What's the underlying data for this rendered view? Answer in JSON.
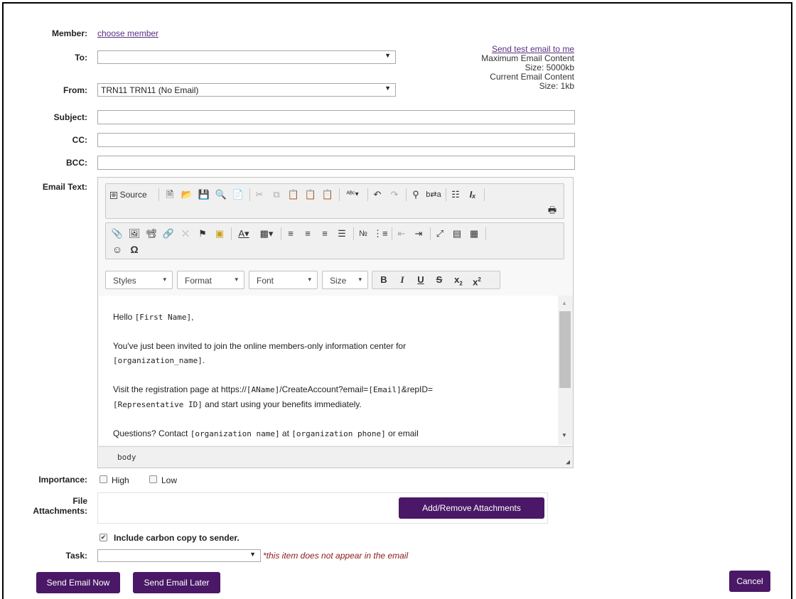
{
  "form": {
    "member_label": "Member:",
    "member_link": "choose member",
    "to_label": "To:",
    "to_value": "",
    "from_label": "From:",
    "from_value": "TRN11 TRN11 (No Email)",
    "subject_label": "Subject:",
    "cc_label": "CC:",
    "bcc_label": "BCC:",
    "email_text_label": "Email Text:",
    "importance_label": "Importance:",
    "importance_high": "High",
    "importance_low": "Low",
    "file_label_1": "File",
    "file_label_2": "Attachments:",
    "add_attachments": "Add/Remove Attachments",
    "carbon_copy_label": "Include carbon copy to sender.",
    "carbon_copy_checked": true,
    "task_label": "Task:",
    "task_value": "",
    "task_note": "*this item does not appear in the email"
  },
  "side": {
    "test_email_link": "Send test email to me",
    "max_size_1": "Maximum Email Content",
    "max_size_2": "Size: 5000kb",
    "cur_size_1": "Current Email Content",
    "cur_size_2": "Size: 1kb"
  },
  "editor": {
    "source_label": "Source",
    "styles": "Styles",
    "format": "Format",
    "font": "Font",
    "size": "Size",
    "status_path": "body",
    "body": {
      "p1_a": "Hello ",
      "p1_b": "[First Name]",
      "p1_c": ",",
      "p2_a": "You've just been invited to join the online members-only information center for",
      "p2_b": "[organization_name]",
      "p2_c": ".",
      "p3_a": "Visit the registration page at https://",
      "p3_b": "[AName]",
      "p3_c": "/CreateAccount?email=",
      "p3_d": "[Email]",
      "p3_e": "&repID=",
      "p3_f": "[Representative ID]",
      "p3_g": " and start using your benefits immediately.",
      "p4_a": "Questions? Contact ",
      "p4_b": "[organization name]",
      "p4_c": " at ",
      "p4_d": "[organization phone]",
      "p4_e": " or email"
    }
  },
  "buttons": {
    "send_now": "Send Email Now",
    "send_later": "Send Email Later",
    "cancel": "Cancel"
  },
  "colors": {
    "brand_purple": "#4a1867",
    "link_purple": "#5a2f82",
    "note_red": "#8b1a1a"
  }
}
